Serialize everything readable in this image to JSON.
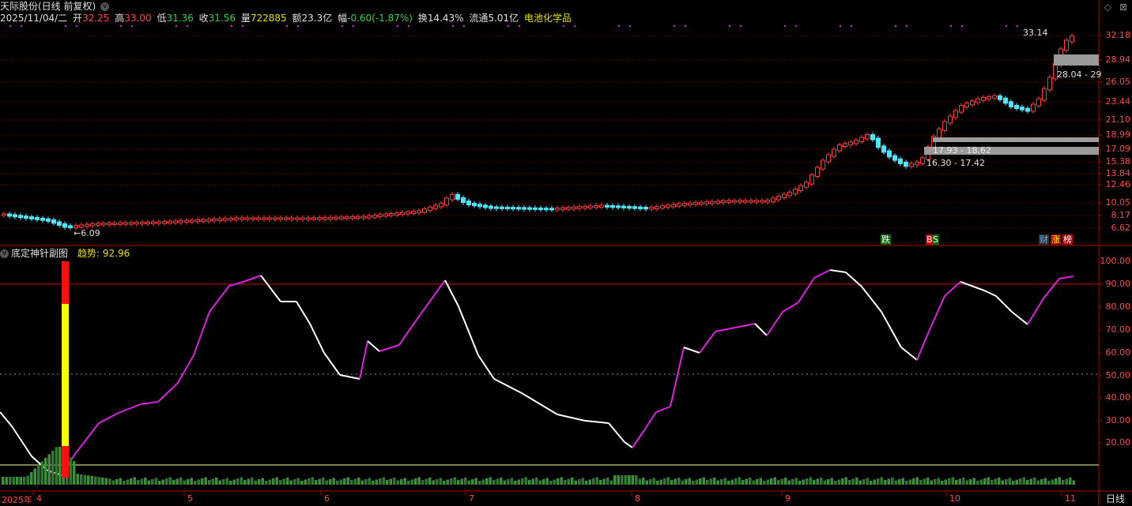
{
  "stock": {
    "title": "天际股份(日线 前复权)",
    "date": "2025/11/04/二",
    "open_label": "开",
    "open": "32.25",
    "high_label": "高",
    "high": "33.00",
    "low_label": "低",
    "low": "31.36",
    "close_label": "收",
    "close": "31.56",
    "volume_label": "量",
    "volume": "722885",
    "amount_label": "额",
    "amount": "23.3亿",
    "change_label": "幅",
    "change": "-0.60(-1.87%)",
    "turnover_label": "换",
    "turnover": "14.43%",
    "float_label": "流通",
    "float": "5.01亿",
    "sector": "电池化学品"
  },
  "price_axis": [
    "32.18",
    "28.94",
    "26.05",
    "23.44",
    "21.10",
    "18.99",
    "17.09",
    "15.38",
    "13.84",
    "12.46",
    "10.05",
    "8.17",
    "6.62"
  ],
  "annotations": {
    "low_mark": "6.09",
    "high_mark": "33.14",
    "zone1": "28.04 - 29",
    "zone2": "17.93 - 18.62",
    "zone3": "16.30 - 17.42"
  },
  "signals": {
    "die": "跌",
    "bs_b": "B",
    "bs_s": "S",
    "cai": "财",
    "zhangting": "涨",
    "bang": "榜"
  },
  "indicator": {
    "name": "底定神针副图",
    "trend_label": "趋势:",
    "trend_value": "92.96",
    "axis": [
      "100.00",
      "90.00",
      "80.00",
      "70.00",
      "60.00",
      "50.00",
      "40.00",
      "30.00",
      "20.00"
    ]
  },
  "time_axis": {
    "year": "2025年",
    "months": [
      "4",
      "5",
      "6",
      "7",
      "8",
      "9",
      "10",
      "11"
    ]
  },
  "period": "日线",
  "colors": {
    "up": "#ff3b3b",
    "down": "#4de6ff",
    "trend_up": "#e020e0",
    "trend_down": "#ffffff",
    "grid": "#6a0000",
    "volume": "#2f7a2f"
  },
  "window_controls": {
    "pin": "◇",
    "close": "⊠"
  }
}
